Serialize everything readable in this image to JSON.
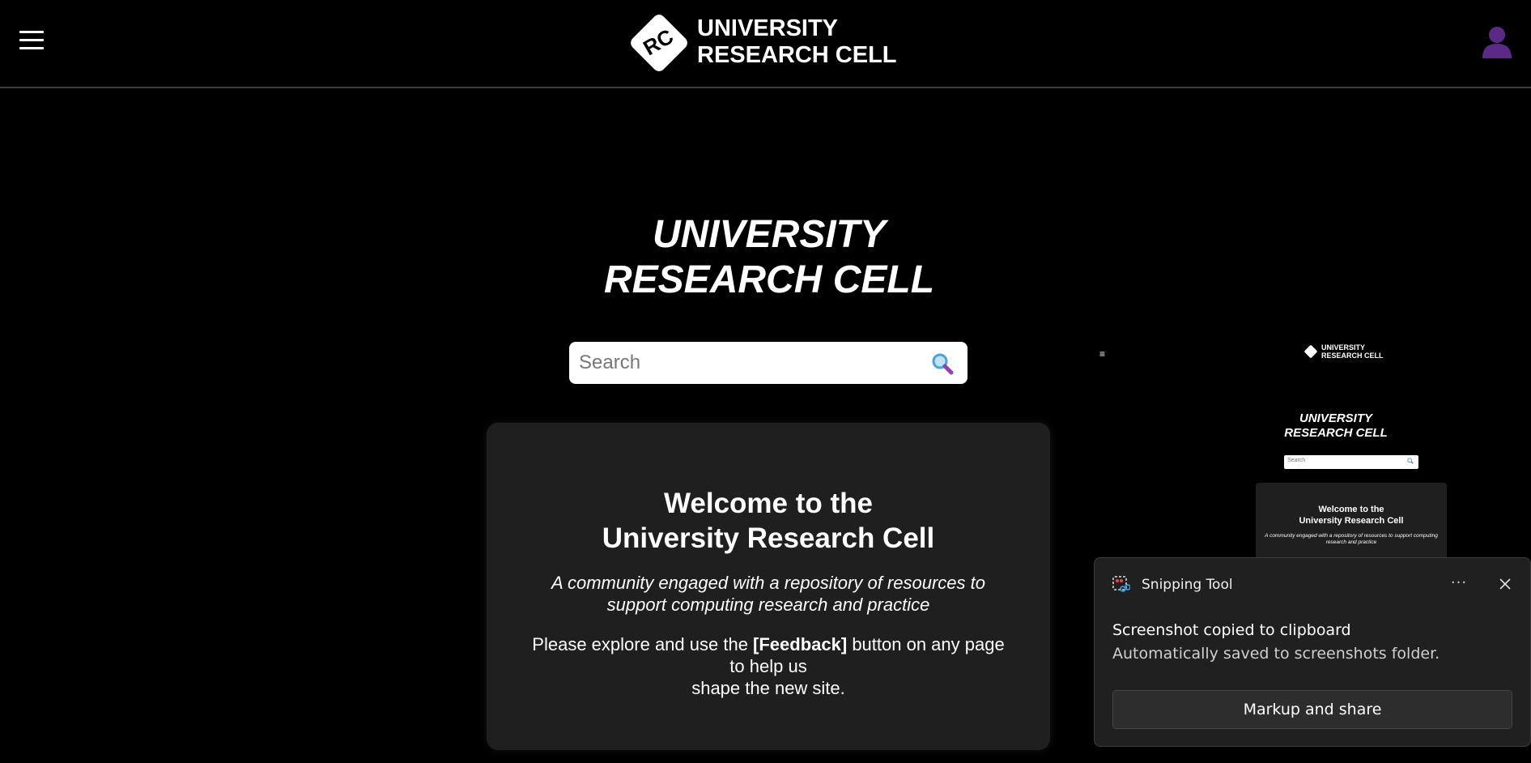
{
  "header": {
    "logo_mark": "RC",
    "logo_line1": "UNIVERSITY",
    "logo_line2": "RESEARCH CELL"
  },
  "hero": {
    "title_line1": "UNIVERSITY",
    "title_line2": "RESEARCH CELL"
  },
  "search": {
    "placeholder": "Search"
  },
  "welcome": {
    "heading_line1": "Welcome to the",
    "heading_line2": "University Research Cell",
    "tagline": "A community engaged with a repository of resources to support computing research and practice",
    "explore_before": "Please explore and use the ",
    "explore_feedback": "[Feedback]",
    "explore_after": " button on any page to help us",
    "explore_line2": "shape the new site."
  },
  "thumbnail": {
    "logo_line1": "UNIVERSITY",
    "logo_line2": "RESEARCH CELL",
    "title_line1": "UNIVERSITY",
    "title_line2": "RESEARCH CELL",
    "search_placeholder": "Search",
    "card_heading_line1": "Welcome to the",
    "card_heading_line2": "University Research Cell",
    "card_tagline": "A community engaged with a repository of resources to support computing research and practice"
  },
  "toast": {
    "app_name": "Snipping Tool",
    "more_label": "···",
    "title": "Screenshot copied to clipboard",
    "subtitle": "Automatically saved to screenshots folder.",
    "action_label": "Markup and share"
  },
  "colors": {
    "background": "#000000",
    "card": "#1f1f1f",
    "avatar": "#5b2a86",
    "search_icon_lens": "#4aa3df",
    "search_icon_handle": "#8e44ad",
    "toast_bg": "#202020"
  },
  "icons": [
    "hamburger-menu-icon",
    "rc-logo-icon",
    "user-avatar-icon",
    "magnifier-search-icon",
    "snipping-tool-icon",
    "more-options-icon",
    "close-icon"
  ]
}
